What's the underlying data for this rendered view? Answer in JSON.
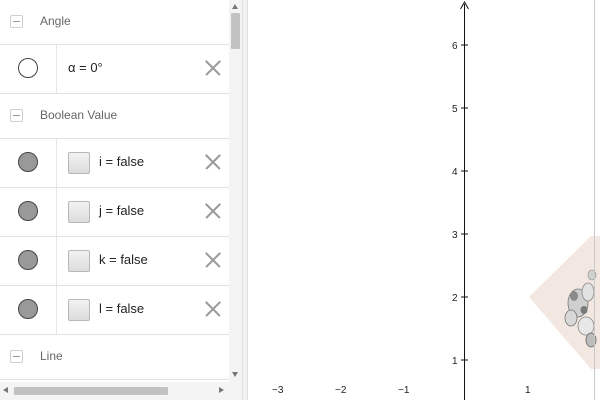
{
  "algebra": {
    "categories": {
      "angle": "Angle",
      "boolean": "Boolean Value",
      "line": "Line"
    },
    "angle_item": {
      "text": "α = 0°",
      "visible": false
    },
    "boolean_items": [
      {
        "text": "i = false",
        "visible": true
      },
      {
        "text": "j = false",
        "visible": true
      },
      {
        "text": "k = false",
        "visible": true
      },
      {
        "text": "l = false",
        "visible": true
      }
    ]
  },
  "graphics": {
    "x_tick_labels": [
      "−3",
      "−2",
      "−1",
      "1"
    ],
    "y_tick_labels": [
      "1",
      "2",
      "3",
      "4",
      "5",
      "6"
    ],
    "image_fill_color": "#f3e7e2"
  }
}
